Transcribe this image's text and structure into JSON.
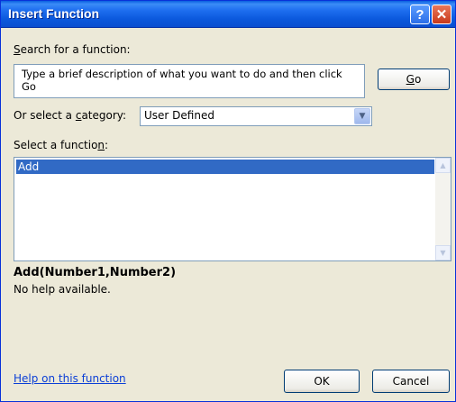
{
  "window": {
    "title": "Insert Function",
    "help_glyph": "?",
    "close_glyph": "✕"
  },
  "search": {
    "label_first": "S",
    "label_rest": "earch for a function:",
    "text": "Type a brief description of what you want to do and then click Go",
    "go_first": "G",
    "go_rest": "o"
  },
  "category": {
    "label_pre": "Or select a ",
    "label_key": "c",
    "label_post": "ategory:",
    "selected": "User Defined"
  },
  "functions": {
    "label_pre": "Select a functio",
    "label_key": "n",
    "label_post": ":",
    "items": [
      "Add"
    ],
    "selected_index": 0
  },
  "details": {
    "signature": "Add(Number1,Number2)",
    "description": "No help available."
  },
  "footer": {
    "help_link": "Help on this function",
    "ok": "OK",
    "cancel": "Cancel"
  }
}
